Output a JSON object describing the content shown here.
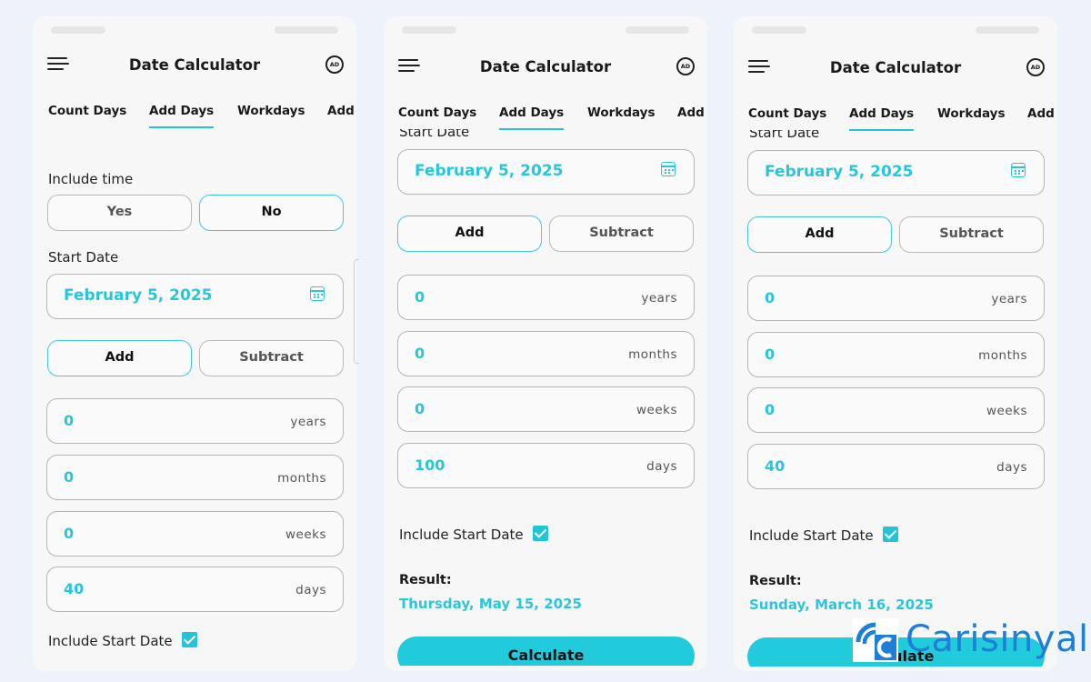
{
  "app": {
    "title": "Date Calculator",
    "ad_icon_text": "AD",
    "tabs": [
      "Count Days",
      "Add Days",
      "Workdays",
      "Add W"
    ]
  },
  "screens": [
    {
      "active_tab": "Add Days",
      "include_time": {
        "label": "Include time",
        "options": [
          "Yes",
          "No"
        ],
        "selected": "No"
      },
      "start_date": {
        "label": "Start Date",
        "value": "February 5, 2025"
      },
      "operation": {
        "options": [
          "Add",
          "Subtract"
        ],
        "selected": "Add"
      },
      "fields": [
        {
          "value": "0",
          "unit": "years"
        },
        {
          "value": "0",
          "unit": "months"
        },
        {
          "value": "0",
          "unit": "weeks"
        },
        {
          "value": "40",
          "unit": "days"
        }
      ],
      "include_start_date": {
        "label": "Include Start Date",
        "checked": true
      }
    },
    {
      "active_tab": "Add Days",
      "start_date": {
        "label": "Start Date",
        "value": "February 5, 2025"
      },
      "operation": {
        "options": [
          "Add",
          "Subtract"
        ],
        "selected": "Add"
      },
      "fields": [
        {
          "value": "0",
          "unit": "years"
        },
        {
          "value": "0",
          "unit": "months"
        },
        {
          "value": "0",
          "unit": "weeks"
        },
        {
          "value": "100",
          "unit": "days"
        }
      ],
      "include_start_date": {
        "label": "Include Start Date",
        "checked": true
      },
      "result": {
        "label": "Result:",
        "value": "Thursday, May 15, 2025"
      },
      "calculate_label": "Calculate"
    },
    {
      "active_tab": "Add Days",
      "start_date": {
        "label": "Start Date",
        "value": "February 5, 2025"
      },
      "operation": {
        "options": [
          "Add",
          "Subtract"
        ],
        "selected": "Add"
      },
      "fields": [
        {
          "value": "0",
          "unit": "years"
        },
        {
          "value": "0",
          "unit": "months"
        },
        {
          "value": "0",
          "unit": "weeks"
        },
        {
          "value": "40",
          "unit": "days"
        }
      ],
      "include_start_date": {
        "label": "Include Start Date",
        "checked": true
      },
      "result": {
        "label": "Result:",
        "value": "Sunday, March 16, 2025"
      },
      "calculate_label": "Calculate"
    }
  ],
  "watermark": {
    "text": "Carisinyal"
  },
  "colors": {
    "accent": "#22c4d8",
    "link_blue": "#1d7fd8",
    "background": "#eef3fb"
  }
}
